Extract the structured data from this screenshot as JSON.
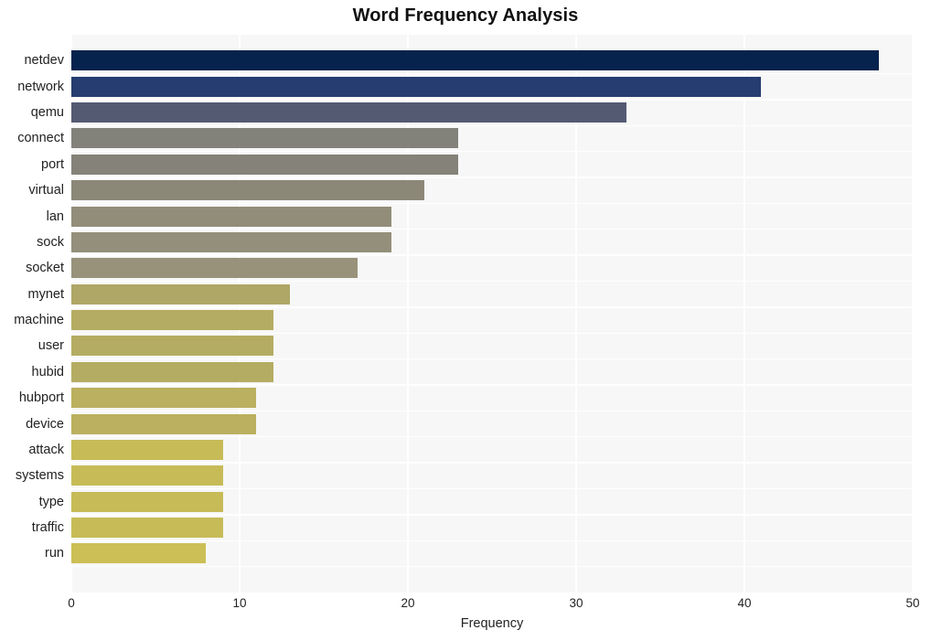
{
  "chart_data": {
    "type": "bar",
    "orientation": "horizontal",
    "title": "Word Frequency Analysis",
    "xlabel": "Frequency",
    "ylabel": "",
    "xlim": [
      0,
      50
    ],
    "xticks": [
      0,
      10,
      20,
      30,
      40,
      50
    ],
    "xtick_labels": [
      "0",
      "10",
      "20",
      "30",
      "40",
      "50"
    ],
    "grid": true,
    "legend": "none",
    "categories": [
      "netdev",
      "network",
      "qemu",
      "connect",
      "port",
      "virtual",
      "lan",
      "sock",
      "socket",
      "mynet",
      "machine",
      "user",
      "hubid",
      "hubport",
      "device",
      "attack",
      "systems",
      "type",
      "traffic",
      "run"
    ],
    "values": [
      48,
      41,
      33,
      23,
      23,
      21,
      19,
      19,
      17,
      13,
      12,
      12,
      12,
      11,
      11,
      9,
      9,
      9,
      9,
      8
    ],
    "bar_colors": [
      "#05234d",
      "#253d70",
      "#545a71",
      "#82827b",
      "#848279",
      "#8c8878",
      "#918d79",
      "#938f7a",
      "#98927a",
      "#aea765",
      "#b5ac63",
      "#b5ac63",
      "#b5ac63",
      "#bbb05f",
      "#bbb05f",
      "#c7bb58",
      "#c7bb58",
      "#c7bb58",
      "#c7bb58",
      "#ccbf55"
    ]
  },
  "style": {
    "plot_background": "#f7f7f7",
    "gridline_color": "#ffffff",
    "page_background": "#ffffff",
    "text_color": "#222222",
    "title_color": "#111111"
  }
}
